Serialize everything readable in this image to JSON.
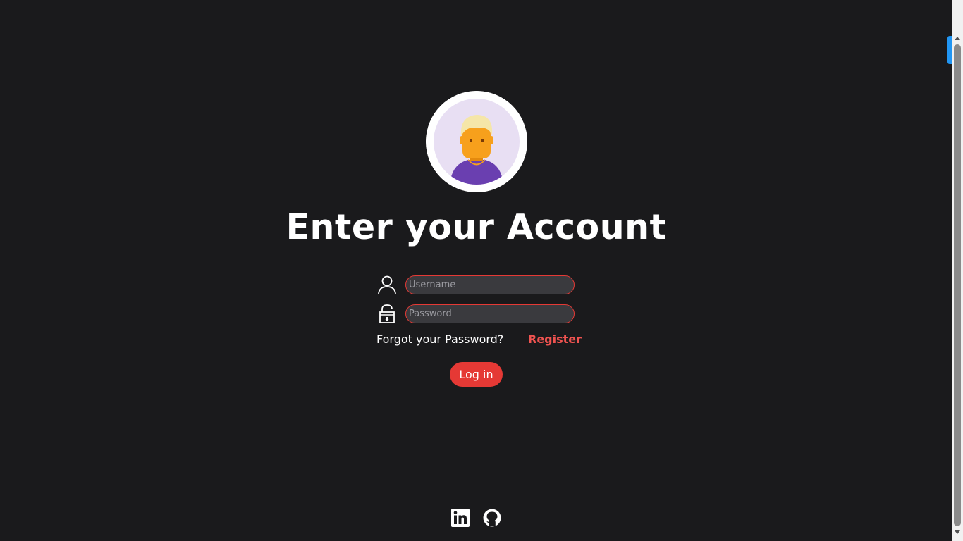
{
  "header": {
    "title": "Enter your Account"
  },
  "avatar": {
    "icon": "user-avatar-icon"
  },
  "form": {
    "username": {
      "icon": "user-icon",
      "value": "",
      "placeholder": "Username"
    },
    "password": {
      "icon": "lock-icon",
      "value": "",
      "placeholder": "Password"
    },
    "forgot_label": "Forgot your Password?",
    "register_label": "Register",
    "login_label": "Log in"
  },
  "footer": {
    "icons": [
      "linkedin-icon",
      "github-icon"
    ]
  },
  "colors": {
    "background": "#1a1a1c",
    "accent": "#e53935",
    "register": "#ef5350",
    "input_bg": "#3a3a3e"
  }
}
